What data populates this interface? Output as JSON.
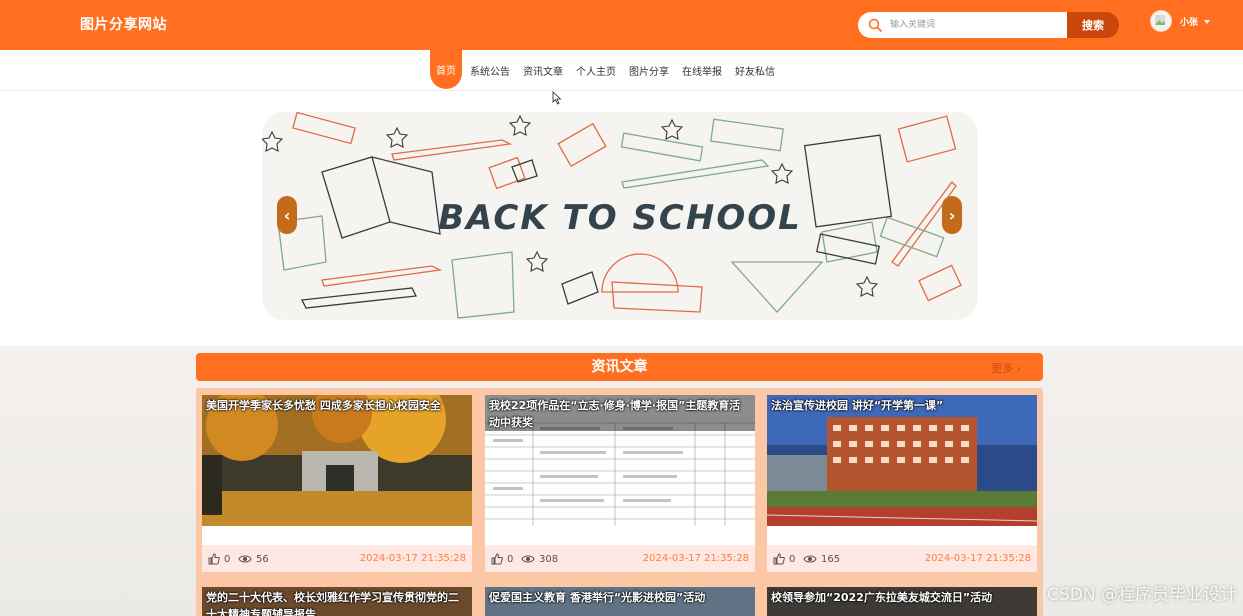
{
  "header": {
    "site_title": "图片分享网站",
    "search": {
      "placeholder": "输入关键词",
      "button_label": "搜索"
    },
    "user": {
      "name": "小张"
    }
  },
  "nav": {
    "items": [
      {
        "label": "首页",
        "active": true
      },
      {
        "label": "系统公告",
        "active": false
      },
      {
        "label": "资讯文章",
        "active": false
      },
      {
        "label": "个人主页",
        "active": false
      },
      {
        "label": "图片分享",
        "active": false
      },
      {
        "label": "在线举报",
        "active": false
      },
      {
        "label": "好友私信",
        "active": false
      }
    ]
  },
  "banner": {
    "text": "BACK TO SCHOOL"
  },
  "articles": {
    "section_title": "资讯文章",
    "more_label": "更多",
    "cards": [
      {
        "title": "美国开学季家长多忧愁 四成多家长担心校园安全",
        "likes": "0",
        "views": "56",
        "date": "2024-03-17 21:35:28"
      },
      {
        "title": "我校22项作品在“立志·修身·博学·报国”主题教育活动中获奖",
        "likes": "0",
        "views": "308",
        "date": "2024-03-17 21:35:28"
      },
      {
        "title": "法治宣传进校园 讲好“开学第一课”",
        "likes": "0",
        "views": "165",
        "date": "2024-03-17 21:35:28"
      }
    ],
    "cards_row2": [
      {
        "title": "党的二十大代表、校长刘雅红作学习宣传贯彻党的二十大精神专题辅导报告"
      },
      {
        "title": "促爱国主义教育 香港举行“光影进校园”活动"
      },
      {
        "title": "校领导参加“2022广东拉美友城交流日”活动"
      }
    ]
  },
  "watermark": "CSDN @程序员毕业设计",
  "colors": {
    "brand": "#ff6f1f",
    "brand_dark": "#c9480b",
    "date": "#ff7e3a",
    "card_footer": "#fde8e4"
  }
}
